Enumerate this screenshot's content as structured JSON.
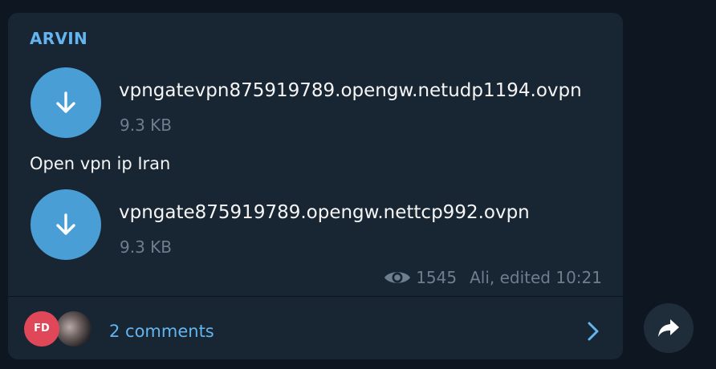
{
  "channel": {
    "name": "ARVIN"
  },
  "files": [
    {
      "name": "vpngatevpn875919789.opengw.netudp1194.ovpn",
      "size": "9.3 KB",
      "icon": "download-icon"
    },
    {
      "name": "vpngate875919789.opengw.nettcp992.ovpn",
      "size": "9.3 KB",
      "icon": "download-icon"
    }
  ],
  "caption": "Open vpn ip Iran",
  "meta": {
    "views": "1545",
    "signature": "Ali, edited 10:21",
    "views_icon": "eye-icon"
  },
  "comments": {
    "label": "2 comments",
    "avatar_initials": "FD",
    "chevron_icon": "chevron-right-icon"
  },
  "share": {
    "icon": "share-icon"
  },
  "colors": {
    "background": "#0e1621",
    "bubble": "#182533",
    "accent": "#64b5ef",
    "download_button": "#4a9ed6",
    "muted_text": "#6d7f8f",
    "avatar_fd": "#e0485a"
  }
}
